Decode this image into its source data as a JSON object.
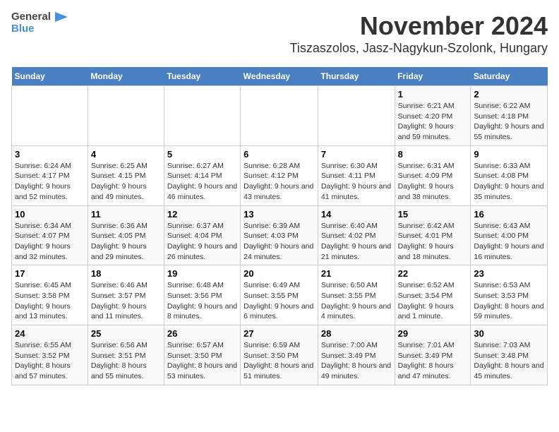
{
  "logo": {
    "line1": "General",
    "line2": "Blue"
  },
  "title": "November 2024",
  "location": "Tiszaszolos, Jasz-Nagykun-Szolonk, Hungary",
  "headers": [
    "Sunday",
    "Monday",
    "Tuesday",
    "Wednesday",
    "Thursday",
    "Friday",
    "Saturday"
  ],
  "weeks": [
    [
      {
        "day": "",
        "info": ""
      },
      {
        "day": "",
        "info": ""
      },
      {
        "day": "",
        "info": ""
      },
      {
        "day": "",
        "info": ""
      },
      {
        "day": "",
        "info": ""
      },
      {
        "day": "1",
        "info": "Sunrise: 6:21 AM\nSunset: 4:20 PM\nDaylight: 9 hours and 59 minutes."
      },
      {
        "day": "2",
        "info": "Sunrise: 6:22 AM\nSunset: 4:18 PM\nDaylight: 9 hours and 55 minutes."
      }
    ],
    [
      {
        "day": "3",
        "info": "Sunrise: 6:24 AM\nSunset: 4:17 PM\nDaylight: 9 hours and 52 minutes."
      },
      {
        "day": "4",
        "info": "Sunrise: 6:25 AM\nSunset: 4:15 PM\nDaylight: 9 hours and 49 minutes."
      },
      {
        "day": "5",
        "info": "Sunrise: 6:27 AM\nSunset: 4:14 PM\nDaylight: 9 hours and 46 minutes."
      },
      {
        "day": "6",
        "info": "Sunrise: 6:28 AM\nSunset: 4:12 PM\nDaylight: 9 hours and 43 minutes."
      },
      {
        "day": "7",
        "info": "Sunrise: 6:30 AM\nSunset: 4:11 PM\nDaylight: 9 hours and 41 minutes."
      },
      {
        "day": "8",
        "info": "Sunrise: 6:31 AM\nSunset: 4:09 PM\nDaylight: 9 hours and 38 minutes."
      },
      {
        "day": "9",
        "info": "Sunrise: 6:33 AM\nSunset: 4:08 PM\nDaylight: 9 hours and 35 minutes."
      }
    ],
    [
      {
        "day": "10",
        "info": "Sunrise: 6:34 AM\nSunset: 4:07 PM\nDaylight: 9 hours and 32 minutes."
      },
      {
        "day": "11",
        "info": "Sunrise: 6:36 AM\nSunset: 4:05 PM\nDaylight: 9 hours and 29 minutes."
      },
      {
        "day": "12",
        "info": "Sunrise: 6:37 AM\nSunset: 4:04 PM\nDaylight: 9 hours and 26 minutes."
      },
      {
        "day": "13",
        "info": "Sunrise: 6:39 AM\nSunset: 4:03 PM\nDaylight: 9 hours and 24 minutes."
      },
      {
        "day": "14",
        "info": "Sunrise: 6:40 AM\nSunset: 4:02 PM\nDaylight: 9 hours and 21 minutes."
      },
      {
        "day": "15",
        "info": "Sunrise: 6:42 AM\nSunset: 4:01 PM\nDaylight: 9 hours and 18 minutes."
      },
      {
        "day": "16",
        "info": "Sunrise: 6:43 AM\nSunset: 4:00 PM\nDaylight: 9 hours and 16 minutes."
      }
    ],
    [
      {
        "day": "17",
        "info": "Sunrise: 6:45 AM\nSunset: 3:58 PM\nDaylight: 9 hours and 13 minutes."
      },
      {
        "day": "18",
        "info": "Sunrise: 6:46 AM\nSunset: 3:57 PM\nDaylight: 9 hours and 11 minutes."
      },
      {
        "day": "19",
        "info": "Sunrise: 6:48 AM\nSunset: 3:56 PM\nDaylight: 9 hours and 8 minutes."
      },
      {
        "day": "20",
        "info": "Sunrise: 6:49 AM\nSunset: 3:55 PM\nDaylight: 9 hours and 6 minutes."
      },
      {
        "day": "21",
        "info": "Sunrise: 6:50 AM\nSunset: 3:55 PM\nDaylight: 9 hours and 4 minutes."
      },
      {
        "day": "22",
        "info": "Sunrise: 6:52 AM\nSunset: 3:54 PM\nDaylight: 9 hours and 1 minute."
      },
      {
        "day": "23",
        "info": "Sunrise: 6:53 AM\nSunset: 3:53 PM\nDaylight: 8 hours and 59 minutes."
      }
    ],
    [
      {
        "day": "24",
        "info": "Sunrise: 6:55 AM\nSunset: 3:52 PM\nDaylight: 8 hours and 57 minutes."
      },
      {
        "day": "25",
        "info": "Sunrise: 6:56 AM\nSunset: 3:51 PM\nDaylight: 8 hours and 55 minutes."
      },
      {
        "day": "26",
        "info": "Sunrise: 6:57 AM\nSunset: 3:50 PM\nDaylight: 8 hours and 53 minutes."
      },
      {
        "day": "27",
        "info": "Sunrise: 6:59 AM\nSunset: 3:50 PM\nDaylight: 8 hours and 51 minutes."
      },
      {
        "day": "28",
        "info": "Sunrise: 7:00 AM\nSunset: 3:49 PM\nDaylight: 8 hours and 49 minutes."
      },
      {
        "day": "29",
        "info": "Sunrise: 7:01 AM\nSunset: 3:49 PM\nDaylight: 8 hours and 47 minutes."
      },
      {
        "day": "30",
        "info": "Sunrise: 7:03 AM\nSunset: 3:48 PM\nDaylight: 8 hours and 45 minutes."
      }
    ]
  ]
}
